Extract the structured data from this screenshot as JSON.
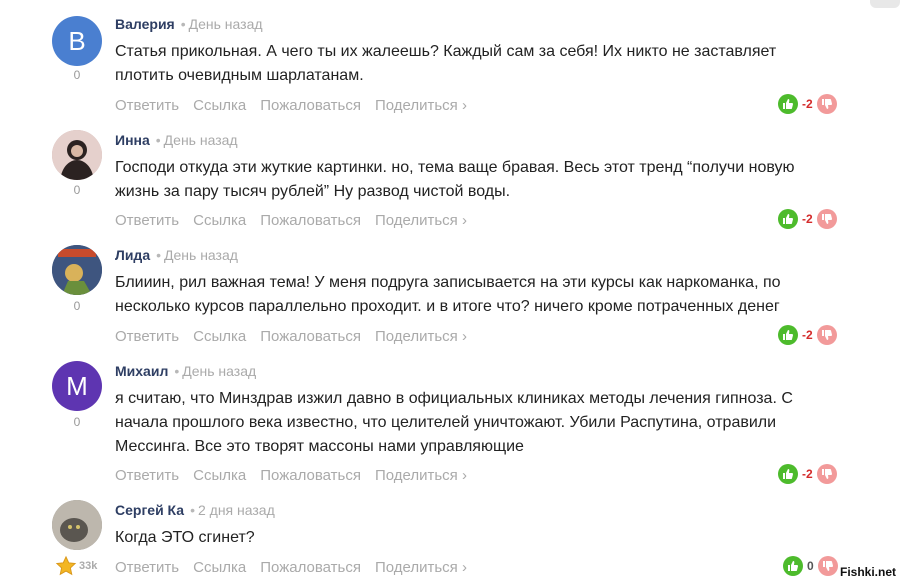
{
  "actions": {
    "reply": "Ответить",
    "link": "Ссылка",
    "report": "Пожаловаться",
    "share": "Поделиться ›"
  },
  "comments": [
    {
      "author": "Валерия",
      "time": "День назад",
      "avatar_letter": "В",
      "avatar_color": "#4a7fd0",
      "score": "0",
      "lines": [
        "Статья прикольная. А чего ты их жалеешь? Каждый сам за себя! Их никто не заставляет",
        "плотить очевидным шарлатанам."
      ],
      "votes": "-2"
    },
    {
      "author": "Инна",
      "time": "День назад",
      "avatar_letter": "",
      "avatar_color": "#c8a7a3",
      "score": "0",
      "lines": [
        "Господи откуда эти жуткие картинки. но, тема ваще бравая. Весь этот тренд “получи новую",
        "жизнь за пару тысяч рублей” Ну развод чистой воды."
      ],
      "votes": "-2"
    },
    {
      "author": "Лида",
      "time": "День назад",
      "avatar_letter": "",
      "avatar_color": "#4a5f8a",
      "score": "0",
      "lines": [
        "Блииин, рил важная тема! У меня подруга записывается на эти курсы как наркоманка, по",
        "несколько курсов параллельно проходит. и в итоге что? ничего кроме потраченных денег"
      ],
      "votes": "-2"
    },
    {
      "author": "Михаил",
      "time": "День назад",
      "avatar_letter": "М",
      "avatar_color": "#5e35b1",
      "score": "0",
      "lines": [
        "я считаю, что Минздрав изжил давно в официальных клиниках методы лечения гипноза. С",
        "начала прошлого века известно, что целителей уничтожают. Убили Распутина, отравили",
        "Мессинга. Все это творят массоны нами управляющие"
      ],
      "votes": "-2"
    },
    {
      "author": "Сергей Ка",
      "time": "2 дня назад",
      "avatar_letter": "",
      "avatar_color": "#8d8a85",
      "score": "",
      "lines": [
        "Когда ЭТО сгинет?"
      ],
      "votes": "0"
    }
  ],
  "rank": "33k",
  "watermark": "Fishki.net",
  "colors": {
    "up": "#4dbb2c",
    "down": "#f29a9a",
    "negative": "#d42a2a",
    "author": "#2e3e63"
  }
}
